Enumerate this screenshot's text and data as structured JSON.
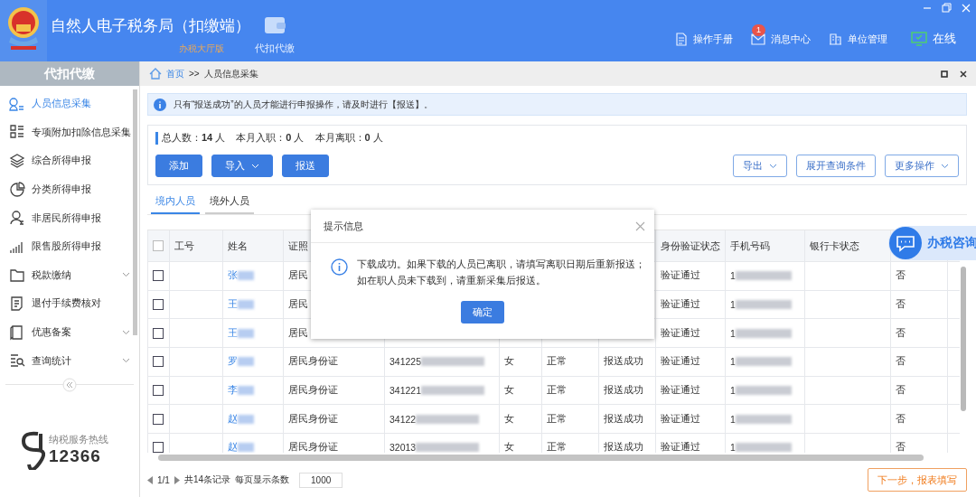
{
  "window": {
    "title": "自然人电子税务局（扣缴端）",
    "edition": "办税大厅版"
  },
  "top_nav": [
    {
      "label": "代扣代缴"
    }
  ],
  "header_links": [
    {
      "label": "操作手册",
      "kind": "manual"
    },
    {
      "label": "消息中心",
      "kind": "messages",
      "badge": "1"
    },
    {
      "label": "单位管理",
      "kind": "units"
    },
    {
      "label": "在线",
      "kind": "online"
    }
  ],
  "sidebar": {
    "title": "代扣代缴",
    "items": [
      {
        "label": "人员信息采集",
        "kind": "item",
        "selected": true
      },
      {
        "label": "专项附加扣除信息采集",
        "kind": "item",
        "selected": false
      },
      {
        "label": "综合所得申报",
        "kind": "item",
        "selected": false
      },
      {
        "label": "分类所得申报",
        "kind": "item",
        "selected": false
      },
      {
        "label": "非居民所得申报",
        "kind": "item",
        "selected": false
      },
      {
        "label": "限售股所得申报",
        "kind": "item",
        "selected": false
      },
      {
        "label": "税款缴纳",
        "kind": "group",
        "selected": false
      },
      {
        "label": "退付手续费核对",
        "kind": "item",
        "selected": false
      },
      {
        "label": "优惠备案",
        "kind": "group",
        "selected": false
      },
      {
        "label": "查询统计",
        "kind": "group",
        "selected": false
      }
    ],
    "hotline": {
      "label": "纳税服务热线",
      "number": "12366"
    }
  },
  "breadcrumb": {
    "home": "首页",
    "separator": ">>",
    "current": "人员信息采集"
  },
  "notice": "只有“报送成功”的人员才能进行申报操作，请及时进行【报送】。",
  "stats": [
    "总人数：**14** 人",
    "本月入职：**0** 人",
    "本月离职：**0** 人"
  ],
  "toolbar": {
    "left": [
      {
        "label": "添加",
        "dropdown": false
      },
      {
        "label": "导入",
        "dropdown": true
      },
      {
        "label": "报送",
        "dropdown": false
      }
    ],
    "right": [
      {
        "label": "导出",
        "dropdown": true
      },
      {
        "label": "展开查询条件",
        "dropdown": false
      },
      {
        "label": "更多操作",
        "dropdown": true
      }
    ]
  },
  "tabs": [
    {
      "label": "境内人员",
      "selected": true
    },
    {
      "label": "境外人员",
      "selected": false
    }
  ],
  "table": {
    "select_all": false,
    "columns": [
      "工号",
      "姓名",
      "证照",
      null,
      null,
      null,
      null,
      "身份验证状态",
      "手机号码",
      "银行卡状态",
      null,
      null
    ],
    "rows": [
      {
        "checked": false,
        "cells": [
          null,
          "张",
          "居民",
          null,
          null,
          null,
          null,
          "验证通过",
          "1",
          null,
          "否",
          null
        ]
      },
      {
        "checked": false,
        "cells": [
          null,
          "王",
          "居民",
          null,
          null,
          null,
          null,
          "验证通过",
          "1",
          null,
          "否",
          null
        ]
      },
      {
        "checked": false,
        "cells": [
          null,
          "王",
          "居民",
          null,
          null,
          null,
          null,
          "验证通过",
          "1",
          null,
          "否",
          null
        ]
      },
      {
        "checked": false,
        "cells": [
          null,
          "罗",
          "居民身份证",
          "341225",
          "女",
          "正常",
          "报送成功",
          "验证通过",
          "1",
          null,
          "否",
          null
        ]
      },
      {
        "checked": false,
        "cells": [
          null,
          "李",
          "居民身份证",
          "341221",
          "女",
          "正常",
          "报送成功",
          "验证通过",
          "1",
          null,
          "否",
          null
        ]
      },
      {
        "checked": false,
        "cells": [
          null,
          "赵",
          "居民身份证",
          "34122",
          "女",
          "正常",
          "报送成功",
          "验证通过",
          "1",
          null,
          "否",
          null
        ]
      },
      {
        "checked": false,
        "cells": [
          null,
          "赵",
          "居民身份证",
          "32013",
          "女",
          "正常",
          "报送成功",
          "验证通过",
          "1",
          null,
          "否",
          null
        ]
      }
    ]
  },
  "pagination": {
    "page": "1/1",
    "total": "共14条记录",
    "page_size_label": "每页显示条数",
    "page_size": "1000"
  },
  "next_button": "下一步，报表填写",
  "dialog": {
    "title": "提示信息",
    "lines": [
      "下载成功。如果下载的人员已离职，请填写离职日期后重新报送；",
      "如在职人员未下载到，请重新采集后报送。"
    ],
    "button": "确定"
  },
  "chat_button": "办税咨询"
}
